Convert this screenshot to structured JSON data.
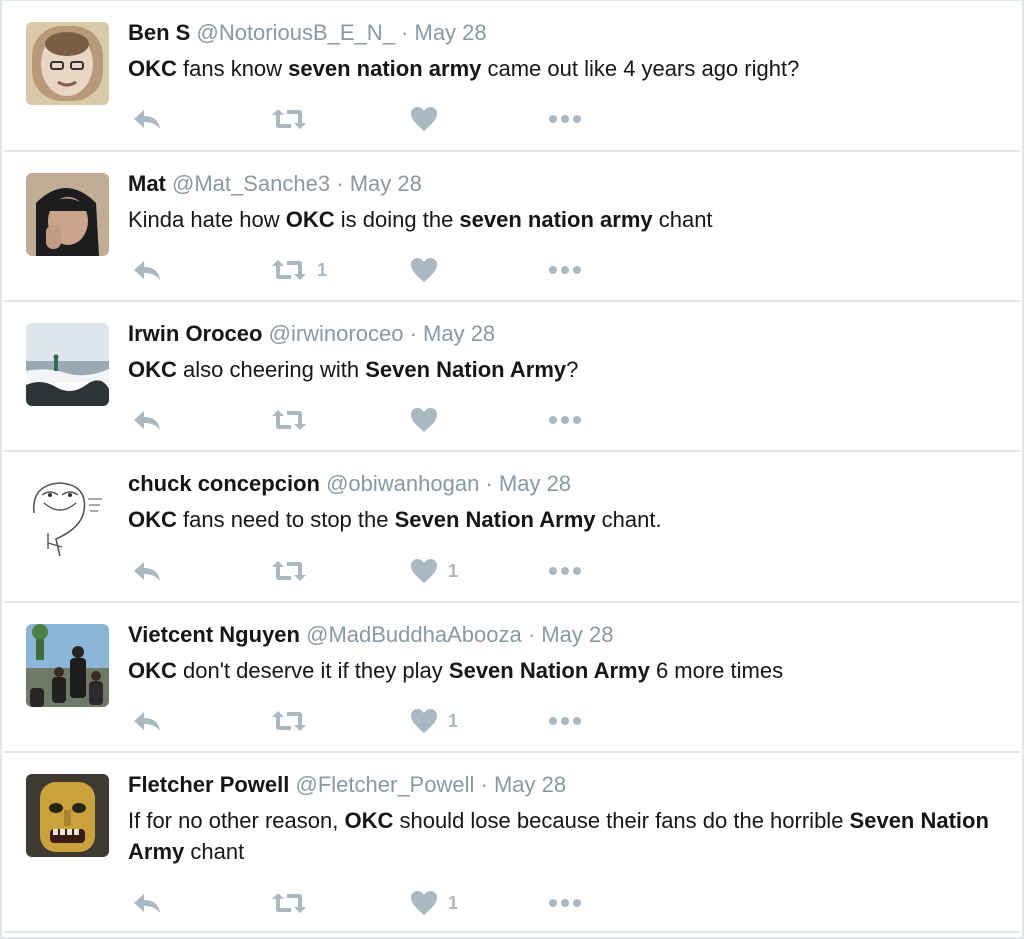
{
  "tweets": [
    {
      "name": "Ben S",
      "handle": "@NotoriousB_E_N_",
      "date": "May 28",
      "text": [
        {
          "t": "OKC",
          "b": true
        },
        {
          "t": " fans know "
        },
        {
          "t": "seven nation army",
          "b": true
        },
        {
          "t": " came out like 4 years ago right?"
        }
      ],
      "retweets": "",
      "likes": "",
      "avatar": "face-photo"
    },
    {
      "name": "Mat",
      "handle": "@Mat_Sanche3",
      "date": "May 28",
      "text": [
        {
          "t": "Kinda hate how "
        },
        {
          "t": "OKC",
          "b": true
        },
        {
          "t": " is doing the "
        },
        {
          "t": "seven nation army",
          "b": true
        },
        {
          "t": " chant"
        }
      ],
      "retweets": "1",
      "likes": "",
      "avatar": "hoodie-photo"
    },
    {
      "name": "Irwin Oroceo",
      "handle": "@irwinoroceo",
      "date": "May 28",
      "text": [
        {
          "t": "OKC",
          "b": true
        },
        {
          "t": " also cheering with "
        },
        {
          "t": "Seven Nation Army",
          "b": true
        },
        {
          "t": "?"
        }
      ],
      "retweets": "",
      "likes": "",
      "avatar": "beach-photo"
    },
    {
      "name": "chuck concepcion",
      "handle": "@obiwanhogan",
      "date": "May 28",
      "text": [
        {
          "t": "OKC",
          "b": true
        },
        {
          "t": " fans need to stop the "
        },
        {
          "t": "Seven Nation Army",
          "b": true
        },
        {
          "t": " chant."
        }
      ],
      "retweets": "",
      "likes": "1",
      "avatar": "sketch-face"
    },
    {
      "name": "Vietcent Nguyen",
      "handle": "@MadBuddhaAbooza",
      "date": "May 28",
      "text": [
        {
          "t": "OKC",
          "b": true
        },
        {
          "t": " don't deserve it if they play "
        },
        {
          "t": "Seven Nation Army",
          "b": true
        },
        {
          "t": " 6 more times"
        }
      ],
      "retweets": "",
      "likes": "1",
      "avatar": "group-photo"
    },
    {
      "name": "Fletcher Powell",
      "handle": "@Fletcher_Powell",
      "date": "May 28",
      "text": [
        {
          "t": "If for no other reason, "
        },
        {
          "t": "OKC",
          "b": true
        },
        {
          "t": " should lose because their fans do the horrible "
        },
        {
          "t": "Seven Nation Army",
          "b": true
        },
        {
          "t": " chant"
        }
      ],
      "retweets": "",
      "likes": "1",
      "avatar": "mask-photo"
    }
  ],
  "separator": "·",
  "colors": {
    "muted": "#8899a6",
    "icon": "#aab8c2",
    "border": "#e1e8ed"
  },
  "icons": {
    "reply": "reply-icon",
    "retweet": "retweet-icon",
    "like": "heart-icon",
    "more": "more-dots-icon"
  }
}
